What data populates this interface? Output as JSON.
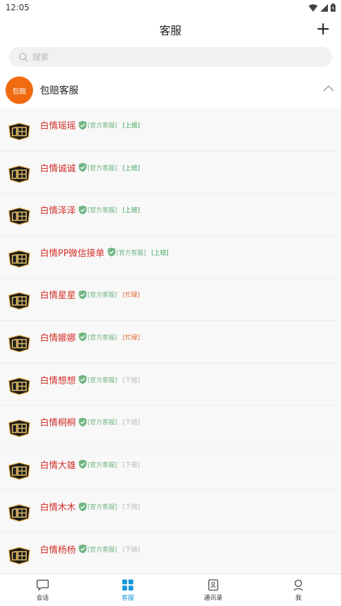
{
  "status_bar": {
    "time": "12:05"
  },
  "header": {
    "title": "客服"
  },
  "search": {
    "placeholder": "搜索"
  },
  "group": {
    "avatar_text": "包赔",
    "title": "包赔客服"
  },
  "colors": {
    "accent_orange": "#f26a10",
    "name_red": "#d4302b",
    "official_green": "#6fb582",
    "on_duty": "#2e9b4e",
    "busy": "#e4652e",
    "off_duty": "#b0b0b0",
    "tab_active": "#1296db"
  },
  "contacts": [
    {
      "name": "白情瑶瑶",
      "official": "[官方客服]",
      "status": "[上班]",
      "status_type": "on"
    },
    {
      "name": "白情诚诚",
      "official": "[官方客服]",
      "status": "[上班]",
      "status_type": "on"
    },
    {
      "name": "白情泽泽",
      "official": "[官方客服]",
      "status": "[上班]",
      "status_type": "on"
    },
    {
      "name": "白情PP微信接单",
      "official": "[官方客服]",
      "status": "[上班]",
      "status_type": "on"
    },
    {
      "name": "白情星星",
      "official": "[官方客服]",
      "status": "[忙碌]",
      "status_type": "busy"
    },
    {
      "name": "白情娜娜",
      "official": "[官方客服]",
      "status": "[忙碌]",
      "status_type": "busy"
    },
    {
      "name": "白情想想",
      "official": "[官方客服]",
      "status": "[下班]",
      "status_type": "off"
    },
    {
      "name": "白情桐桐",
      "official": "[官方客服]",
      "status": "[下班]",
      "status_type": "off"
    },
    {
      "name": "白情大雄",
      "official": "[官方客服]",
      "status": "[下班]",
      "status_type": "off"
    },
    {
      "name": "白情木木",
      "official": "[官方客服]",
      "status": "[下班]",
      "status_type": "off"
    },
    {
      "name": "白情杨杨",
      "official": "[官方客服]",
      "status": "[下班]",
      "status_type": "off"
    }
  ],
  "tabs": [
    {
      "label": "会话",
      "icon": "chat-icon",
      "active": false
    },
    {
      "label": "客服",
      "icon": "grid-icon",
      "active": true
    },
    {
      "label": "通讯录",
      "icon": "contacts-book-icon",
      "active": false
    },
    {
      "label": "我",
      "icon": "person-icon",
      "active": false
    }
  ]
}
